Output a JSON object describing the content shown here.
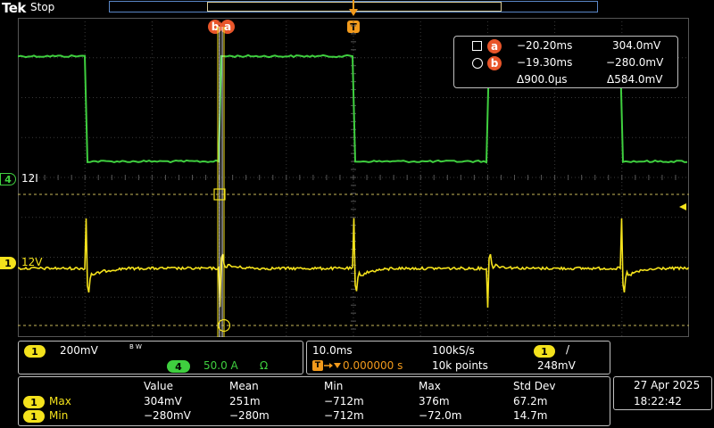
{
  "top": {
    "logo": "Tek",
    "status": "Stop"
  },
  "cursor_labels": {
    "b": "b",
    "a": "a",
    "trigger": "T"
  },
  "channels": {
    "ch4": {
      "number": "4",
      "label": "12I",
      "color": "#3fcf3f"
    },
    "ch1": {
      "number": "1",
      "label": "12V",
      "color": "#f4e21c"
    }
  },
  "cursor_readout": {
    "a": {
      "badge": "a",
      "time": "−20.20ms",
      "value": "304.0mV"
    },
    "b": {
      "badge": "b",
      "time": "−19.30ms",
      "value": "−280.0mV"
    },
    "delta_time": "Δ900.0µs",
    "delta_value": "Δ584.0mV"
  },
  "vertical_panel": {
    "ch1_num": "1",
    "ch1_scale": "200mV",
    "bw": "B W",
    "ch4_num": "4",
    "ch4_scale": "50.0 A",
    "ch4_unit": "Ω"
  },
  "horizontal_panel": {
    "timebase": "10.0ms",
    "sample_rate": "100kS/s",
    "trig_channel": "1",
    "trig_slope": "/",
    "trig_label": "T",
    "trig_position": "0.000000 s",
    "record_length": "10k points",
    "trig_level": "248mV"
  },
  "measurements": {
    "headers": [
      "Value",
      "Mean",
      "Min",
      "Max",
      "Std Dev"
    ],
    "rows": [
      {
        "ch": "1",
        "name": "Max",
        "values": [
          "304mV",
          "251m",
          "−712m",
          "376m",
          "67.2m"
        ]
      },
      {
        "ch": "1",
        "name": "Min",
        "values": [
          "−280mV",
          "−280m",
          "−712m",
          "−72.0m",
          "14.7m"
        ]
      }
    ]
  },
  "datetime": {
    "date": "27 Apr  2025",
    "time": "18:22:42"
  },
  "colors": {
    "ch1": "#f4e21c",
    "ch4": "#3fcf3f",
    "accent": "#e8552a",
    "timebar": "#5a86c6"
  }
}
